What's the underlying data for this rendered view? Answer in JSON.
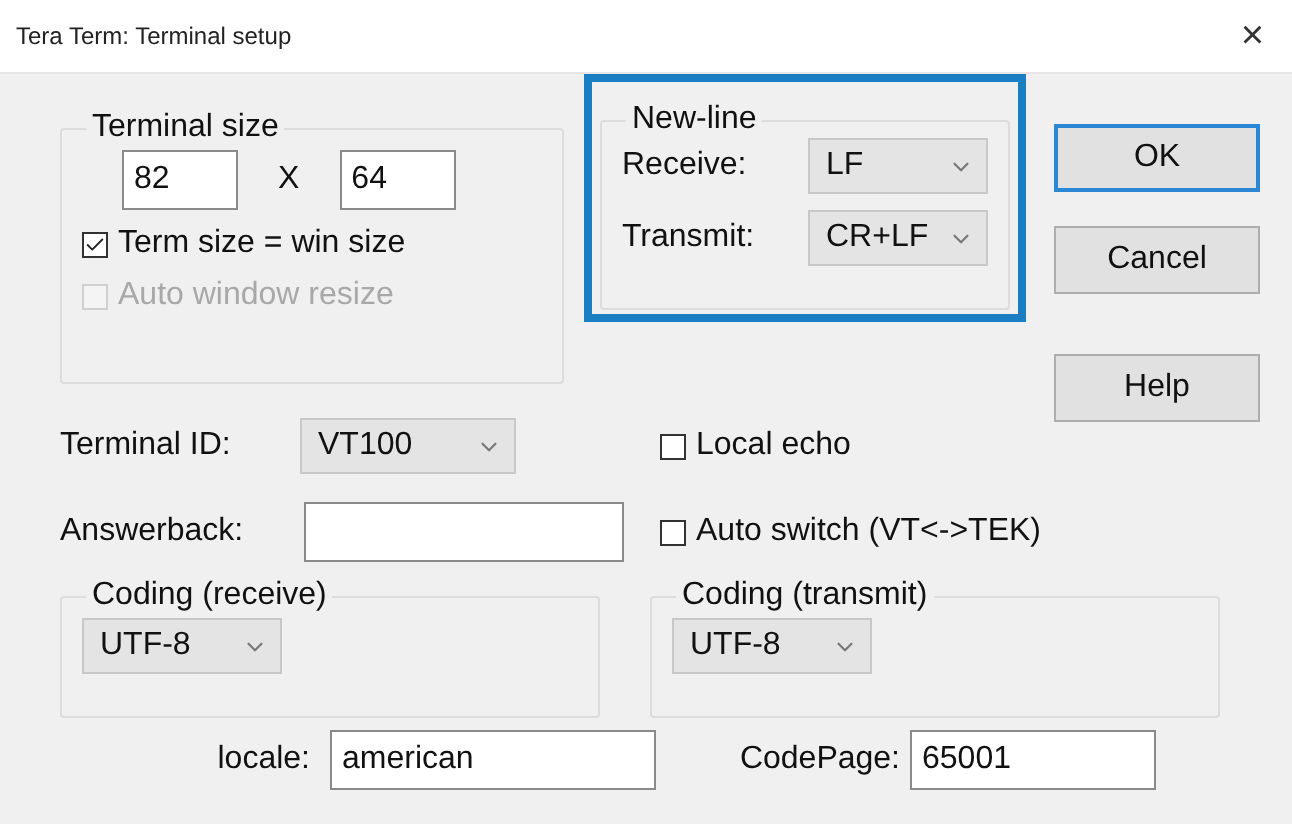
{
  "window": {
    "title": "Tera Term: Terminal setup",
    "close": "×"
  },
  "terminal_size": {
    "label": "Terminal size",
    "columns": "82",
    "separator": "X",
    "rows": "64",
    "checkboxes": [
      {
        "label": "Term size = win size",
        "checked": true,
        "disabled": false
      },
      {
        "label": "Auto window resize",
        "checked": false,
        "disabled": true
      }
    ]
  },
  "new_line": {
    "label": "New-line",
    "highlighted": true,
    "fields": [
      {
        "label": "Receive:",
        "value": "LF"
      },
      {
        "label": "Transmit:",
        "value": "CR+LF"
      }
    ]
  },
  "buttons": [
    {
      "label": "OK",
      "default": true
    },
    {
      "label": "Cancel",
      "default": false
    },
    {
      "label": "Help",
      "default": false
    }
  ],
  "terminal_id": {
    "label": "Terminal ID:",
    "value": "VT100"
  },
  "answerback": {
    "label": "Answerback:"
  },
  "options": [
    {
      "label": "Local echo",
      "checked": false
    },
    {
      "label": "Auto switch (VT<->TEK)",
      "checked": false
    }
  ],
  "coding": [
    {
      "label": "Coding (receive)",
      "value": "UTF-8"
    },
    {
      "label": "Coding (transmit)",
      "value": "UTF-8"
    }
  ],
  "locale": {
    "label": "locale:",
    "value": "american"
  },
  "codepage": {
    "label": "CodePage:",
    "value": "65001"
  }
}
